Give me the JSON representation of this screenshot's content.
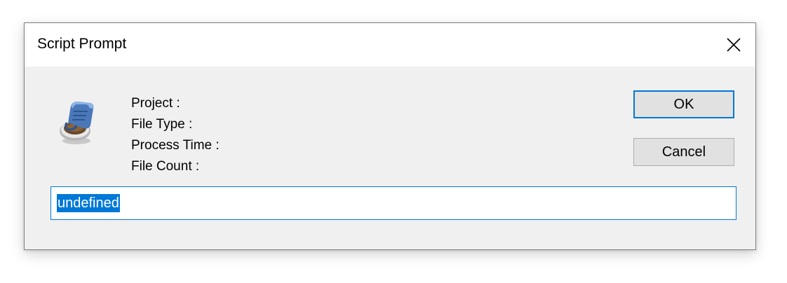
{
  "dialog": {
    "title": "Script Prompt",
    "close_icon": "close-icon",
    "app_icon": "script-icon"
  },
  "info": {
    "project_label": "Project :",
    "file_type_label": "File Type :",
    "process_time_label": "Process Time :",
    "file_count_label": "File Count :"
  },
  "buttons": {
    "ok_label": "OK",
    "cancel_label": "Cancel"
  },
  "input": {
    "value": "undefined"
  },
  "colors": {
    "accent": "#0078d7",
    "dialog_background": "#f0f0f0",
    "titlebar_background": "#ffffff",
    "button_background": "#e1e1e1"
  }
}
